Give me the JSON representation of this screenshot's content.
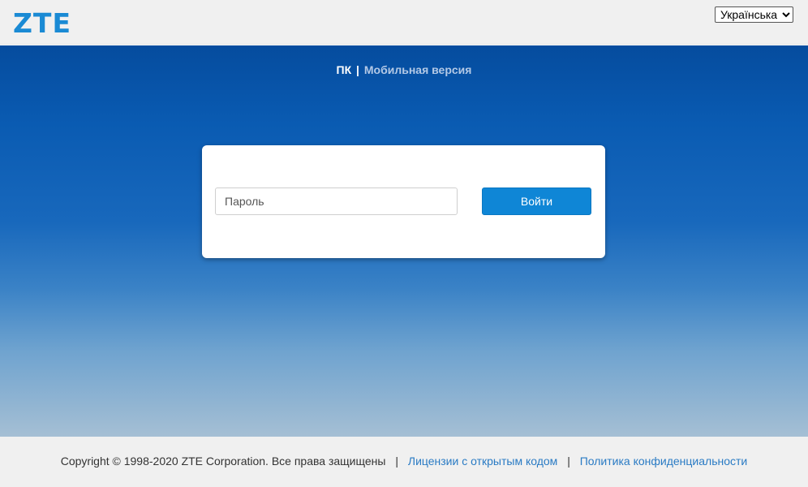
{
  "header": {
    "logo_text": "ZTE",
    "language": {
      "selected": "Українська",
      "options": [
        "Українська"
      ]
    }
  },
  "view_switch": {
    "pc_label": "ПК",
    "separator": "|",
    "mobile_label": "Мобильная версия"
  },
  "login": {
    "password_placeholder": "Пароль",
    "password_value": "",
    "submit_label": "Войти"
  },
  "footer": {
    "copyright": "Copyright © 1998-2020 ZTE Corporation. Все права защищены",
    "separator": "|",
    "open_source_link": "Лицензии с открытым кодом",
    "privacy_link": "Политика конфиденциальности"
  },
  "colors": {
    "brand": "#1a8ad4",
    "button": "#0f86d6",
    "link": "#2a7bc4",
    "background_top": "#054c9e",
    "background_bottom": "#a5bfd4"
  },
  "icons": {
    "language_select": "chevron-down-icon"
  }
}
